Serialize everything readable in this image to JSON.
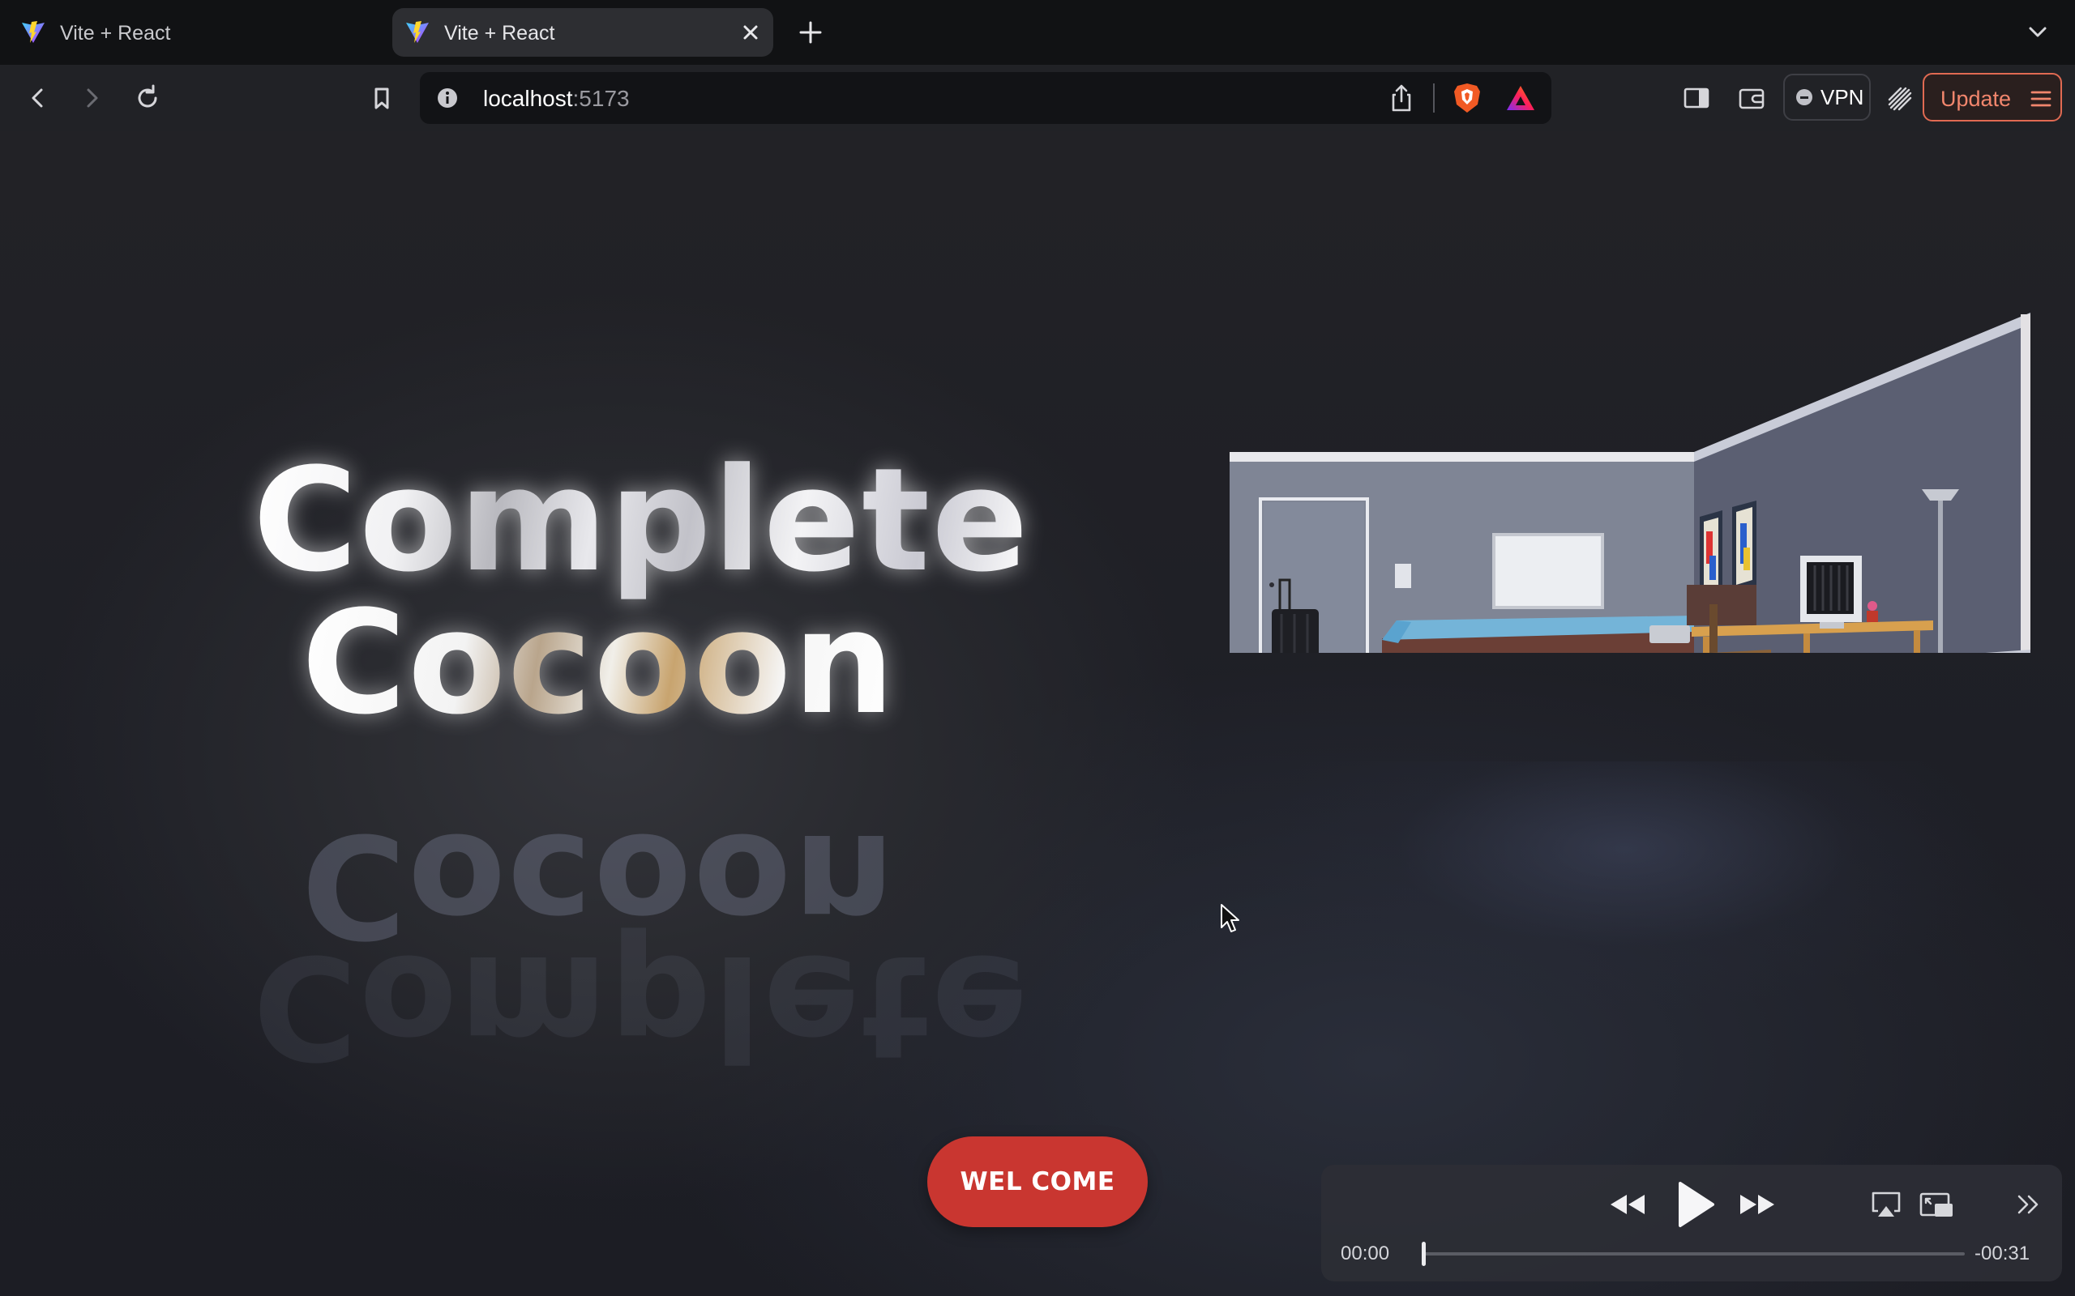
{
  "browser": {
    "tabs": [
      {
        "title": "Vite + React",
        "active": false
      },
      {
        "title": "Vite + React",
        "active": true
      }
    ],
    "url_host": "localhost",
    "url_port": ":5173",
    "vpn_label": "VPN",
    "update_label": "Update",
    "accent_update": "#f2866d"
  },
  "page": {
    "hero_line1": "Complete",
    "hero_line2": "Cocoon",
    "cta_label": "WEL COME",
    "cta_color": "#c93630"
  },
  "video": {
    "current_time": "00:00",
    "remaining_time": "-00:31",
    "progress": 0
  }
}
